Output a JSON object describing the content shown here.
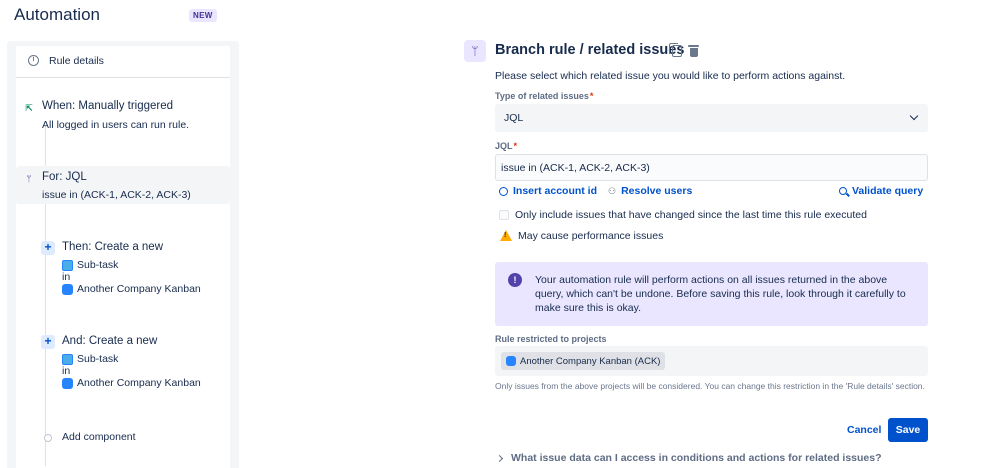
{
  "header": {
    "title": "Automation",
    "badge": "NEW"
  },
  "rule": {
    "details_label": "Rule details",
    "trigger": {
      "title": "When: Manually triggered",
      "subtitle": "All logged in users can run rule."
    },
    "branch": {
      "title": "For: JQL",
      "subtitle": "issue in (ACK-1, ACK-2, ACK-3)"
    },
    "actions": [
      {
        "title": "Then: Create a new",
        "issue_type": "Sub-task",
        "in_label": "in",
        "project": "Another Company Kanban"
      },
      {
        "title": "And: Create a new",
        "issue_type": "Sub-task",
        "in_label": "in",
        "project": "Another Company Kanban"
      }
    ],
    "add_component": "Add component"
  },
  "config": {
    "title": "Branch rule / related issues",
    "description": "Please select which related issue you would like to perform actions against.",
    "type_label": "Type of related issues",
    "type_value": "JQL",
    "jql_label": "JQL",
    "jql_value": "issue in (ACK-1, ACK-2, ACK-3)",
    "links": {
      "insert_account": "Insert account id",
      "resolve_users": "Resolve users",
      "validate": "Validate query"
    },
    "checkbox_label": "Only include issues that have changed since the last time this rule executed",
    "checkbox_checked": false,
    "warning": "May cause performance issues",
    "note": "Your automation rule will perform actions on all issues returned in the above query, which can't be undone. Before saving this rule, look through it carefully to make sure this is okay.",
    "restricted_label": "Rule restricted to projects",
    "restricted_project": "Another Company Kanban (ACK)",
    "help_text": "Only issues from the above projects will be considered. You can change this restriction in the 'Rule details' section.",
    "cancel": "Cancel",
    "save": "Save",
    "faq": "What issue data can I access in conditions and actions for related issues?"
  },
  "colors": {
    "primary": "#0052cc",
    "note_bg": "#eae6ff",
    "note_icon": "#5243aa",
    "warning": "#ffab00",
    "required": "#de350b",
    "trigger_icon": "#00875a"
  }
}
